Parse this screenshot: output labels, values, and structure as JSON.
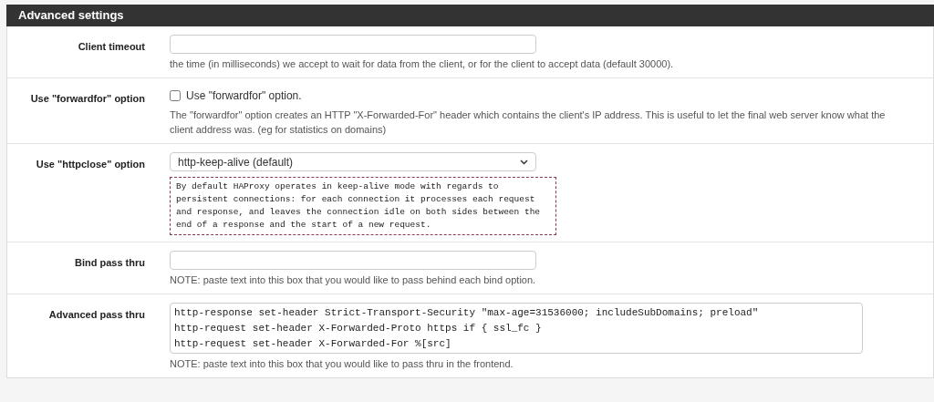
{
  "panel": {
    "title": "Advanced settings"
  },
  "rows": [
    {
      "kind": "input",
      "label": "Client timeout",
      "value": "",
      "help": "the time (in milliseconds) we accept to wait for data from the client, or for the client to accept data (default 30000)."
    },
    {
      "kind": "checkbox",
      "label": "Use \"forwardfor\" option",
      "checkbox_label": "Use \"forwardfor\" option.",
      "checked": false,
      "help": "The \"forwardfor\" option creates an HTTP \"X-Forwarded-For\" header which contains the client's IP address. This is useful to let the final web server know what the client address was. (eg for statistics on domains)"
    },
    {
      "kind": "select",
      "label": "Use \"httpclose\" option",
      "value": "http-keep-alive (default)",
      "description": "By default HAProxy operates in keep-alive mode with regards to persistent connections: for each connection it processes each request and response, and leaves the connection idle on both sides between the end of a response and the start of a new request."
    },
    {
      "kind": "input",
      "label": "Bind pass thru",
      "value": "",
      "help": "NOTE: paste text into this box that you would like to pass behind each bind option."
    },
    {
      "kind": "textarea",
      "label": "Advanced pass thru",
      "value": "http-response set-header Strict-Transport-Security \"max-age=31536000; includeSubDomains; preload\"\nhttp-request set-header X-Forwarded-Proto https if { ssl_fc }\nhttp-request set-header X-Forwarded-For %[src]",
      "help": "NOTE: paste text into this box that you would like to pass thru in the frontend."
    }
  ]
}
